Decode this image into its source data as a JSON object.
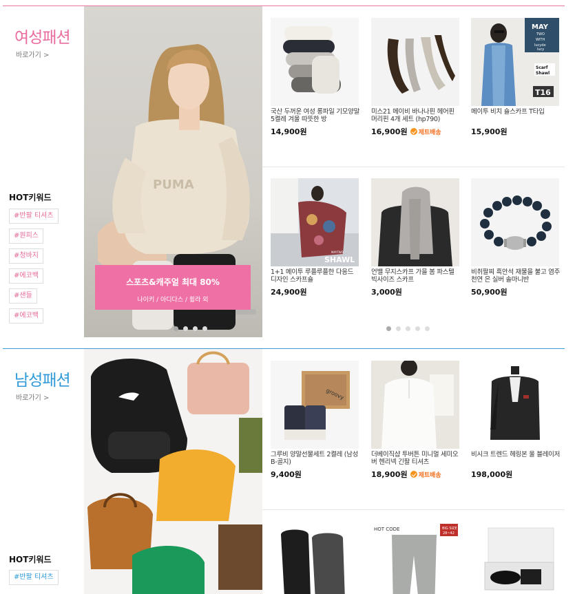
{
  "women": {
    "title": "여성패션",
    "go_label": "바로가기 >",
    "hot_title": "HOT키워드",
    "keywords": [
      "#반팔 티셔츠",
      "#원피스",
      "#청바지",
      "#에코백",
      "#샌들",
      "#에코백"
    ],
    "promo_title": "스포츠&캐주얼 최대 80%",
    "promo_sub": "나이키 / 아디다스 / 휠라 외",
    "banner_logo": "PUMA",
    "products": [
      {
        "name": "국산 두꺼운 여성 롱파일 기모양말 5켤레 겨울 따뜻한 방",
        "price": "14,900원"
      },
      {
        "name": "미스21 메이비 바나나핀 헤어핀 머리핀 4개 세트 (hp790)",
        "price": "16,900원",
        "badge": "제트배송"
      },
      {
        "name": "메이투 비치 숄스카프 T타입",
        "price": "15,900원",
        "img_text": [
          "MAY",
          "TWO",
          "WITH",
          "lucyde",
          "lucy",
          "Scarf",
          "Shawl",
          "T16"
        ]
      },
      {
        "name": "1+1 메이투 루플루플한 다응드 디자인 스카프숄",
        "price": "24,900원",
        "img_text": [
          "SHAWL",
          "MAYTWO"
        ]
      },
      {
        "name": "언밸 무지스카프 가을 봄 파스텔 빅사이즈 스카프",
        "price": "3,000원"
      },
      {
        "name": "비취팔찌 흑안석 재물을 불고 염주 천연 은 실버 솔마니반",
        "price": "50,900원"
      }
    ]
  },
  "men": {
    "title": "남성패션",
    "go_label": "바로가기 >",
    "hot_title": "HOT키워드",
    "keywords": [
      "#반팔 티셔츠"
    ],
    "products": [
      {
        "name": "그루비 양말선물세트 2켤레 (남성B-골지)",
        "price": "9,400원",
        "img_text": [
          "groovy"
        ]
      },
      {
        "name": "더베이직샵 투버튼 미니멀 세미오버 헨리넥 긴팔 티셔츠",
        "price": "18,900원",
        "badge": "제트배송"
      },
      {
        "name": "비시크 트렌드 헤링본 울 블레이저",
        "price": "198,000원"
      },
      {
        "name": "",
        "price": ""
      },
      {
        "name": "",
        "price": "",
        "img_text": [
          "HOT CODE",
          "BIG SIZE",
          "28~42"
        ]
      },
      {
        "name": "",
        "price": ""
      }
    ]
  },
  "colors": {
    "women_accent": "#ea6b9d",
    "men_accent": "#2f9ad8",
    "promo_bg": "#ee70a4",
    "jet_badge": "#f37020"
  }
}
